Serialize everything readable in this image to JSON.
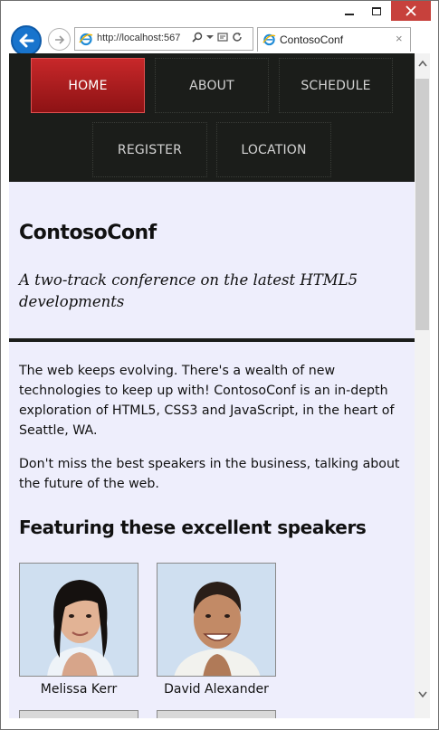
{
  "browser": {
    "address_url": "http://localhost:567",
    "tab_title": "ContosoConf",
    "close_tab_glyph": "×"
  },
  "site": {
    "nav": [
      {
        "label": "HOME",
        "active": true
      },
      {
        "label": "ABOUT",
        "active": false
      },
      {
        "label": "SCHEDULE",
        "active": false
      },
      {
        "label": "REGISTER",
        "active": false
      },
      {
        "label": "LOCATION",
        "active": false
      }
    ],
    "title": "ContosoConf",
    "tagline": "A two-track conference on the latest HTML5 developments",
    "paragraph1": "The web keeps evolving. There's a wealth of new technologies to keep up with! ContosoConf is an in-depth exploration of HTML5, CSS3 and JavaScript, in the heart of Seattle, WA.",
    "paragraph2": "Don't miss the best speakers in the business, talking about the future of the web.",
    "speakers_heading": "Featuring these excellent speakers",
    "speakers": [
      {
        "name": "Melissa Kerr"
      },
      {
        "name": "David Alexander"
      }
    ]
  },
  "colors": {
    "nav_background": "#1b1d1a",
    "nav_active": "#b01e20",
    "page_background": "#eeeefc",
    "close_button": "#c7413c"
  },
  "icons": [
    "back-arrow-icon",
    "forward-arrow-icon",
    "ie-logo-icon",
    "search-icon",
    "refresh-icon",
    "compat-view-icon",
    "minimize-icon",
    "maximize-icon",
    "close-icon"
  ]
}
